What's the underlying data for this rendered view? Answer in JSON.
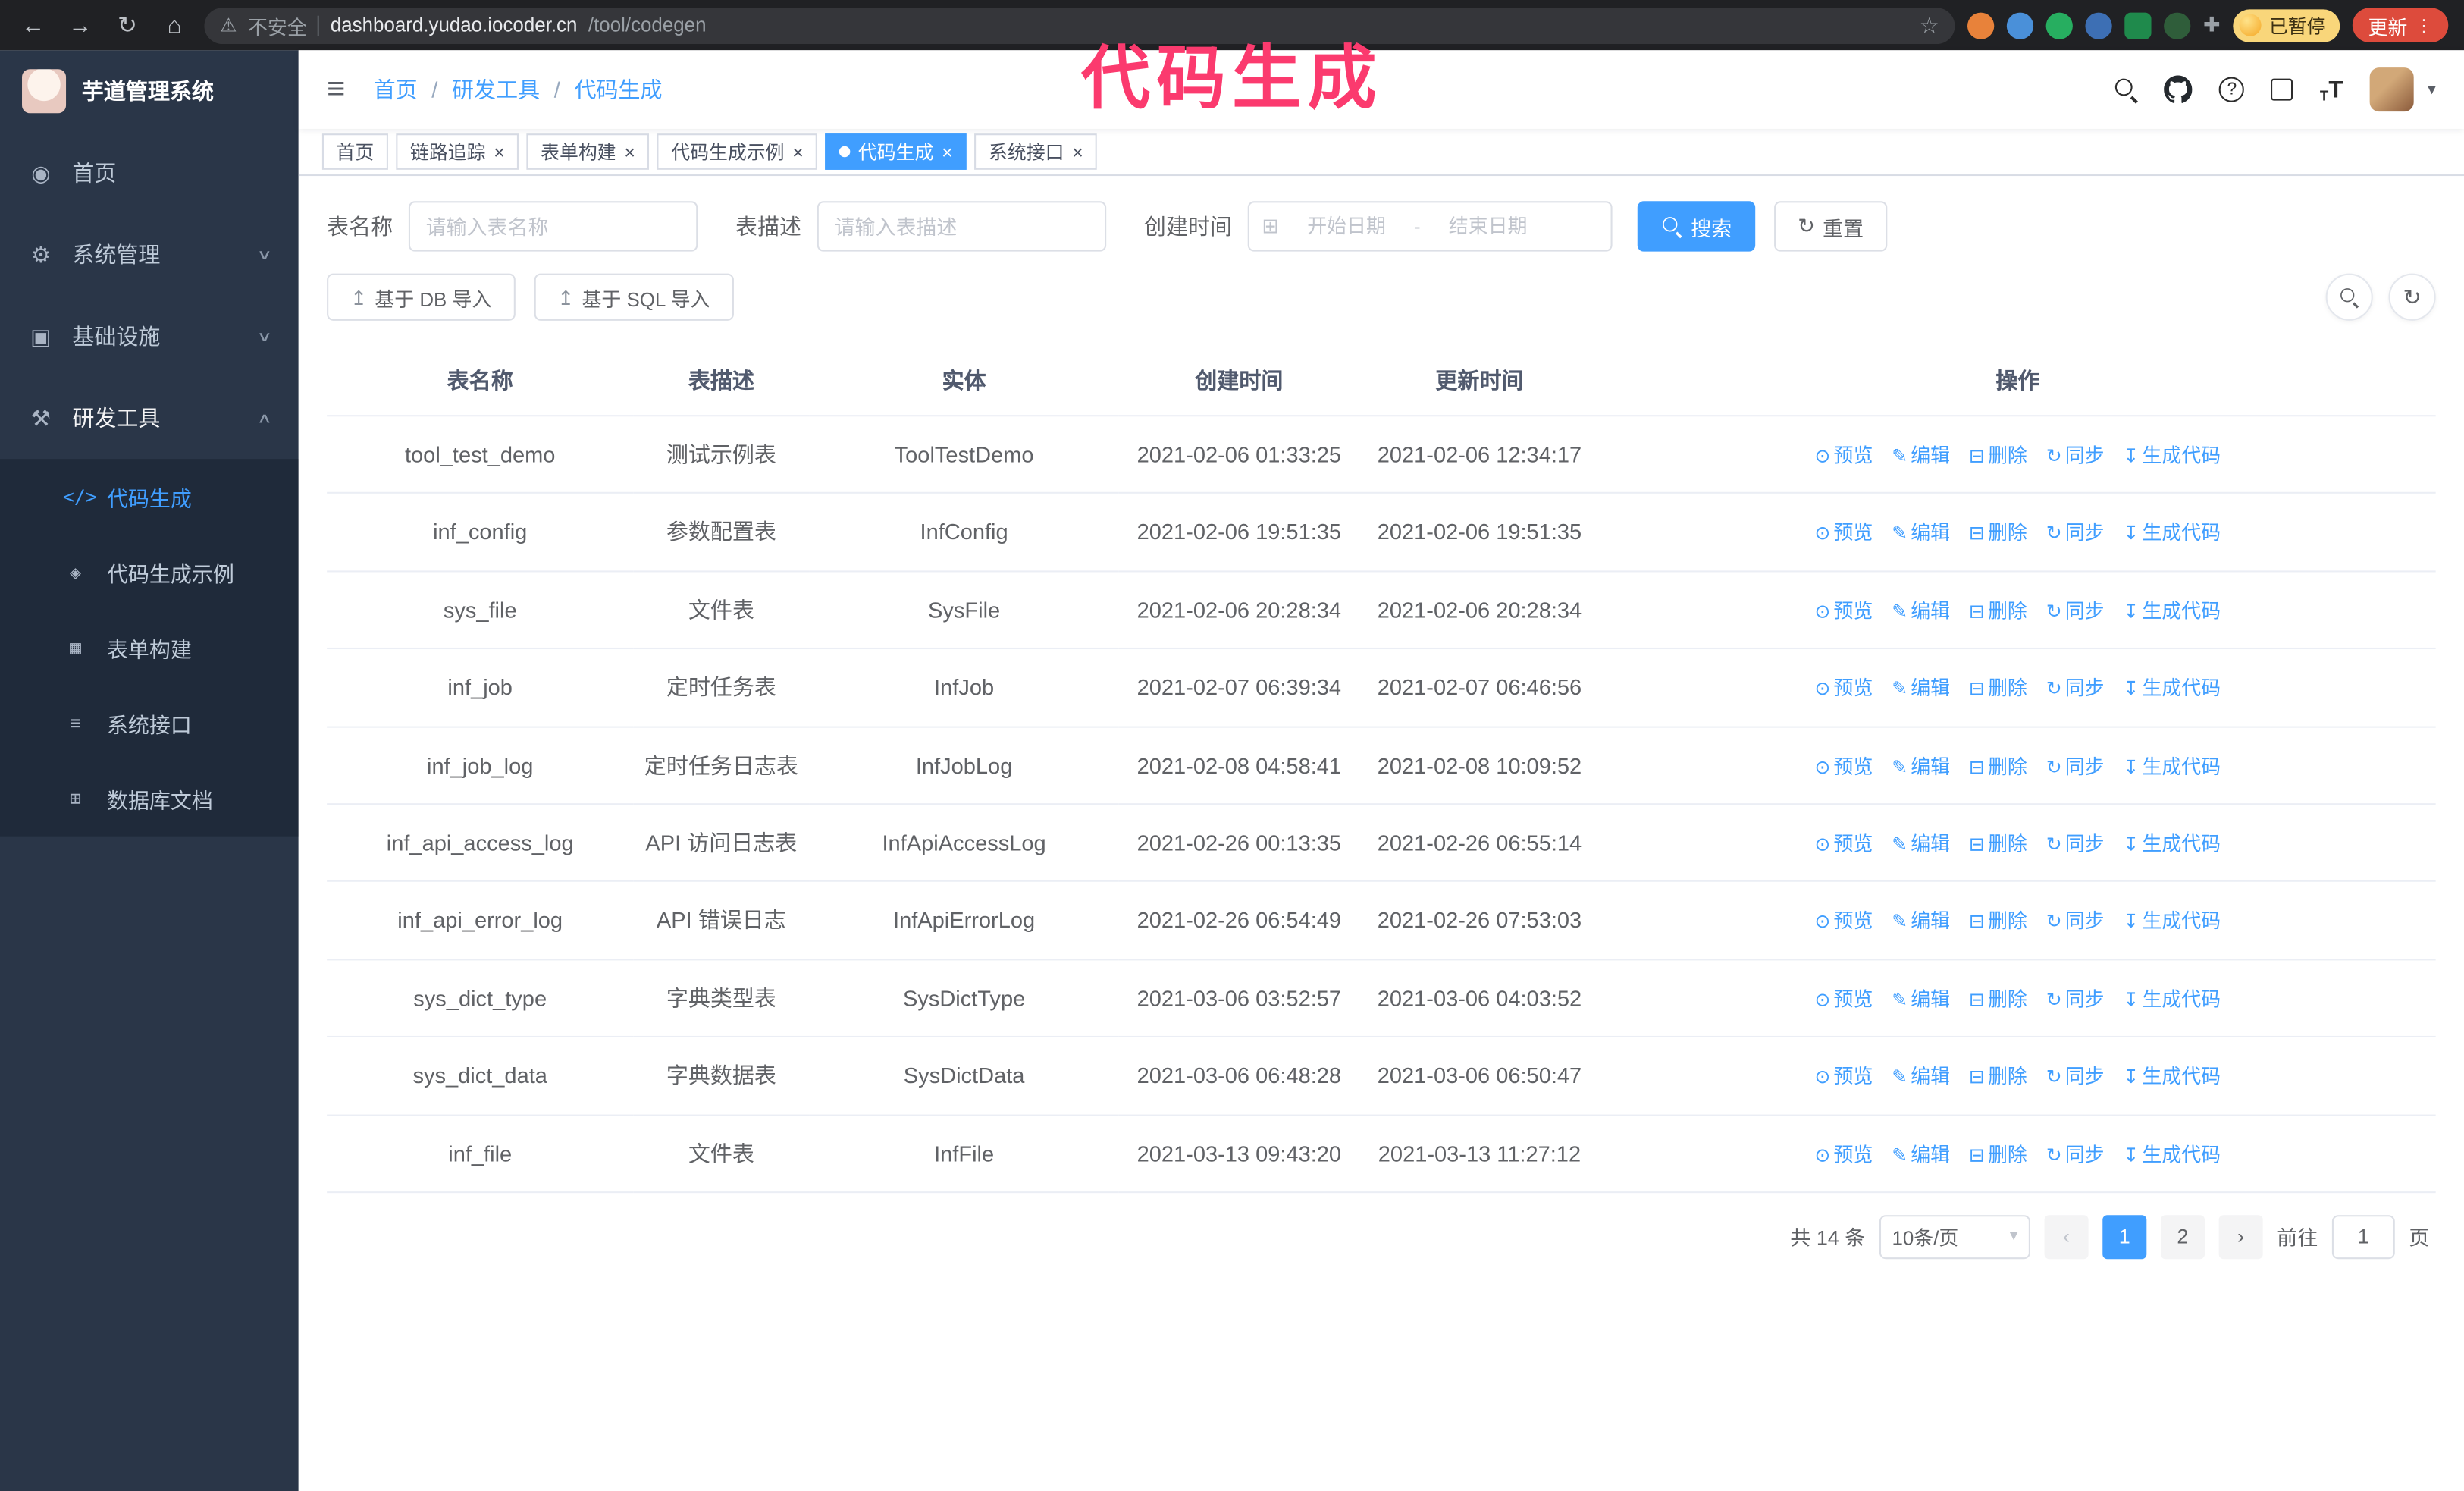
{
  "browser": {
    "security_text": "不安全",
    "url_host": "dashboard.yudao.iocoder.cn",
    "url_path": "/tool/codegen",
    "paused_label": "已暂停",
    "update_label": "更新"
  },
  "annotation": {
    "text": "代码生成"
  },
  "icons": {
    "back": "←",
    "forward": "→",
    "reload": "↻",
    "home": "⌂",
    "warning": "⚠",
    "star": "☆",
    "hamburger": "≡",
    "question": "?",
    "caret_down": "▾",
    "calendar": "⊞",
    "upload": "↥",
    "refresh": "↻",
    "prev": "‹",
    "next": "›",
    "font_big": "T",
    "font_small": "T",
    "dots": "⋮",
    "sep": "/",
    "date_dash": "-"
  },
  "sidebar": {
    "logo_title": "芋道管理系统",
    "items": [
      {
        "name": "home",
        "label": "首页",
        "icon": "◉",
        "chevron": null
      },
      {
        "name": "system-management",
        "label": "系统管理",
        "icon": "⚙",
        "chevron": "down"
      },
      {
        "name": "infrastructure",
        "label": "基础设施",
        "icon": "▣",
        "chevron": "down"
      },
      {
        "name": "dev-tools",
        "label": "研发工具",
        "icon": "⚒",
        "chevron": "up",
        "active_parent": true
      }
    ],
    "submenu": [
      {
        "name": "codegen",
        "label": "代码生成",
        "icon": "</>",
        "active": true
      },
      {
        "name": "codegen-example",
        "label": "代码生成示例",
        "icon": "◈"
      },
      {
        "name": "form-builder",
        "label": "表单构建",
        "icon": "▦"
      },
      {
        "name": "system-api",
        "label": "系统接口",
        "icon": "≡"
      },
      {
        "name": "db-doc",
        "label": "数据库文档",
        "icon": "⊞"
      }
    ]
  },
  "header": {
    "breadcrumb": [
      "首页",
      "研发工具",
      "代码生成"
    ]
  },
  "tabs": [
    {
      "label": "首页",
      "closable": false,
      "active": false
    },
    {
      "label": "链路追踪",
      "closable": true,
      "active": false
    },
    {
      "label": "表单构建",
      "closable": true,
      "active": false
    },
    {
      "label": "代码生成示例",
      "closable": true,
      "active": false
    },
    {
      "label": "代码生成",
      "closable": true,
      "active": true
    },
    {
      "label": "系统接口",
      "closable": true,
      "active": false
    }
  ],
  "filters": {
    "table_name_label": "表名称",
    "table_name_placeholder": "请输入表名称",
    "table_desc_label": "表描述",
    "table_desc_placeholder": "请输入表描述",
    "create_time_label": "创建时间",
    "date_start_placeholder": "开始日期",
    "date_end_placeholder": "结束日期",
    "search_label": "搜索",
    "reset_label": "重置"
  },
  "toolbar": {
    "import_db_label": "基于 DB 导入",
    "import_sql_label": "基于 SQL 导入"
  },
  "table": {
    "columns": [
      "表名称",
      "表描述",
      "实体",
      "创建时间",
      "更新时间",
      "操作"
    ],
    "ops": [
      {
        "name": "preview",
        "icon": "⊙",
        "label": "预览"
      },
      {
        "name": "edit",
        "icon": "✎",
        "label": "编辑"
      },
      {
        "name": "delete",
        "icon": "⊟",
        "label": "删除"
      },
      {
        "name": "sync",
        "icon": "↻",
        "label": "同步"
      },
      {
        "name": "generate-code",
        "icon": "↧",
        "label": "生成代码"
      }
    ],
    "rows": [
      {
        "name": "tool_test_demo",
        "desc": "测试示例表",
        "entity": "ToolTestDemo",
        "created": "2021-02-06 01:33:25",
        "updated": "2021-02-06 12:34:17"
      },
      {
        "name": "inf_config",
        "desc": "参数配置表",
        "entity": "InfConfig",
        "created": "2021-02-06 19:51:35",
        "updated": "2021-02-06 19:51:35"
      },
      {
        "name": "sys_file",
        "desc": "文件表",
        "entity": "SysFile",
        "created": "2021-02-06 20:28:34",
        "updated": "2021-02-06 20:28:34"
      },
      {
        "name": "inf_job",
        "desc": "定时任务表",
        "entity": "InfJob",
        "created": "2021-02-07 06:39:34",
        "updated": "2021-02-07 06:46:56"
      },
      {
        "name": "inf_job_log",
        "desc": "定时任务日志表",
        "entity": "InfJobLog",
        "created": "2021-02-08 04:58:41",
        "updated": "2021-02-08 10:09:52"
      },
      {
        "name": "inf_api_access_log",
        "desc": "API 访问日志表",
        "entity": "InfApiAccessLog",
        "created": "2021-02-26 00:13:35",
        "updated": "2021-02-26 06:55:14"
      },
      {
        "name": "inf_api_error_log",
        "desc": "API 错误日志",
        "entity": "InfApiErrorLog",
        "created": "2021-02-26 06:54:49",
        "updated": "2021-02-26 07:53:03"
      },
      {
        "name": "sys_dict_type",
        "desc": "字典类型表",
        "entity": "SysDictType",
        "created": "2021-03-06 03:52:57",
        "updated": "2021-03-06 04:03:52"
      },
      {
        "name": "sys_dict_data",
        "desc": "字典数据表",
        "entity": "SysDictData",
        "created": "2021-03-06 06:48:28",
        "updated": "2021-03-06 06:50:47"
      },
      {
        "name": "inf_file",
        "desc": "文件表",
        "entity": "InfFile",
        "created": "2021-03-13 09:43:20",
        "updated": "2021-03-13 11:27:12"
      }
    ]
  },
  "pagination": {
    "total_label": "共 14 条",
    "page_size_label": "10条/页",
    "pages": [
      {
        "label": "1",
        "active": true
      },
      {
        "label": "2",
        "active": false
      }
    ],
    "goto_label": "前往",
    "goto_value": "1",
    "goto_suffix": "页"
  }
}
